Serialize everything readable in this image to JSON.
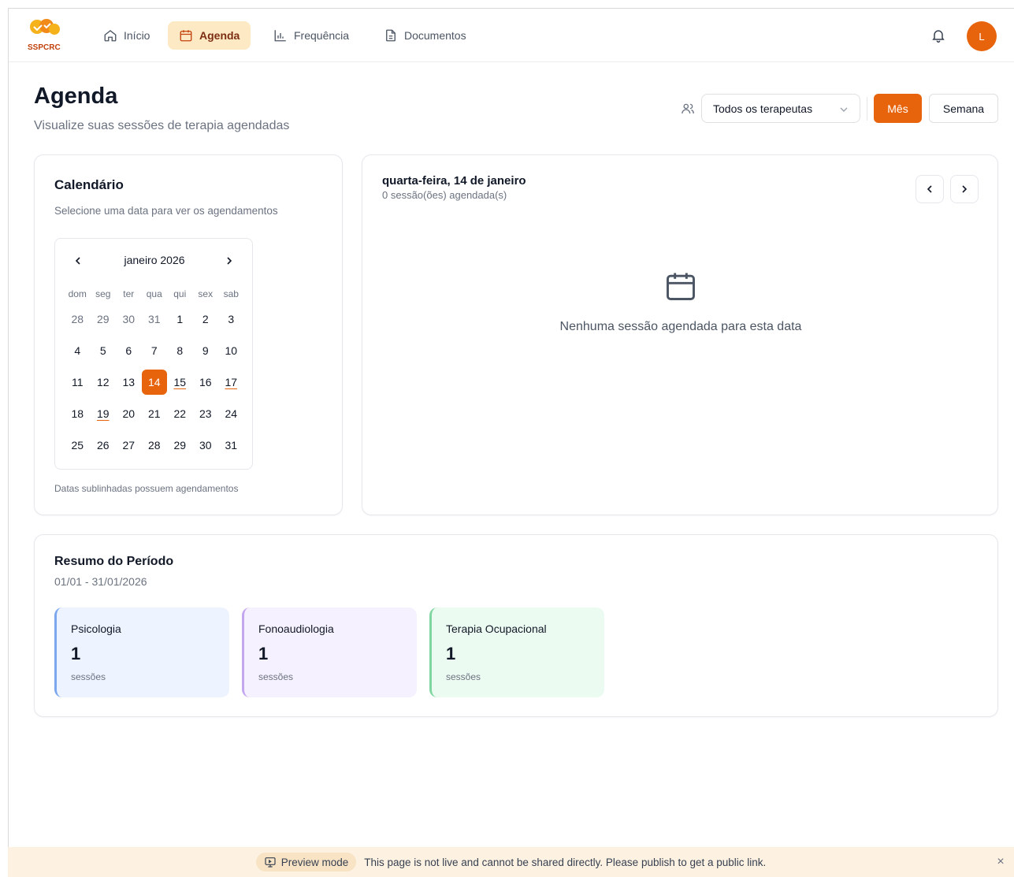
{
  "nav": {
    "logo_text": "SSPCRC",
    "items": [
      {
        "label": "Início",
        "icon": "home-icon"
      },
      {
        "label": "Agenda",
        "icon": "calendar-icon",
        "active": true
      },
      {
        "label": "Frequência",
        "icon": "bar-chart-icon"
      },
      {
        "label": "Documentos",
        "icon": "document-icon"
      }
    ],
    "avatar_initial": "L"
  },
  "header": {
    "title": "Agenda",
    "subtitle": "Visualize suas sessões de terapia agendadas",
    "therapist_filter": "Todos os terapeutas",
    "view_month": "Mês",
    "view_week": "Semana"
  },
  "calendar": {
    "title": "Calendário",
    "description": "Selecione uma data para ver os agendamentos",
    "month_label": "janeiro 2026",
    "weekdays": [
      "dom",
      "seg",
      "ter",
      "qua",
      "qui",
      "sex",
      "sab"
    ],
    "weeks": [
      [
        "28",
        "29",
        "30",
        "31",
        "1",
        "2",
        "3"
      ],
      [
        "4",
        "5",
        "6",
        "7",
        "8",
        "9",
        "10"
      ],
      [
        "11",
        "12",
        "13",
        "14",
        "15",
        "16",
        "17"
      ],
      [
        "18",
        "19",
        "20",
        "21",
        "22",
        "23",
        "24"
      ],
      [
        "25",
        "26",
        "27",
        "28",
        "29",
        "30",
        "31"
      ]
    ],
    "outside_days_first_week": 4,
    "selected_day": "14",
    "marked_days": [
      "15",
      "17",
      "19"
    ],
    "note": "Datas sublinhadas possuem agendamentos"
  },
  "day_panel": {
    "date_title": "quarta-feira, 14 de janeiro",
    "session_count": "0 sessão(ões) agendada(s)",
    "empty_message": "Nenhuma sessão agendada para esta data"
  },
  "summary": {
    "title": "Resumo do Período",
    "range": "01/01 - 31/01/2026",
    "stats": [
      {
        "name": "Psicologia",
        "value": "1",
        "unit": "sessões",
        "bg": "#eef4ff",
        "accent": "#7aa7ee"
      },
      {
        "name": "Fonoaudiologia",
        "value": "1",
        "unit": "sessões",
        "bg": "#f6f1fe",
        "accent": "#c4a6ee"
      },
      {
        "name": "Terapia Ocupacional",
        "value": "1",
        "unit": "sessões",
        "bg": "#ecfbf1",
        "accent": "#7fd6a0"
      }
    ]
  },
  "preview": {
    "pill_label": "Preview mode",
    "message": "This page is not live and cannot be shared directly. Please publish to get a public link.",
    "close": "×"
  },
  "colors": {
    "accent": "#e8640c",
    "nav_active_bg": "#fde9c4"
  }
}
